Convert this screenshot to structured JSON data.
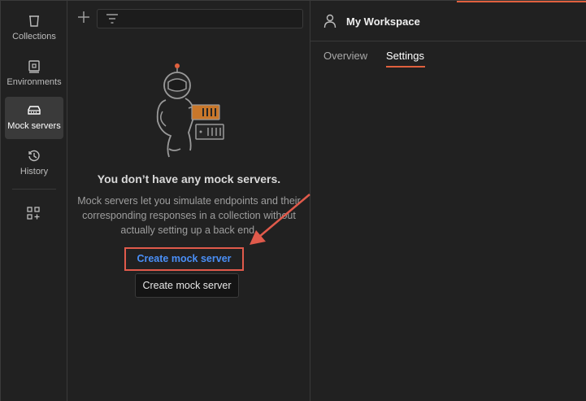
{
  "rail": {
    "items": [
      {
        "label": "Collections",
        "icon": "collections-icon"
      },
      {
        "label": "Environments",
        "icon": "environments-icon"
      },
      {
        "label": "Mock servers",
        "icon": "mock-servers-icon",
        "active": true
      },
      {
        "label": "History",
        "icon": "history-icon"
      }
    ],
    "more_icon": "configure-sidebar-icon"
  },
  "panel": {
    "empty_title": "You don’t have any mock servers.",
    "empty_desc": "Mock servers let you simulate endpoints and their corresponding responses in a collection without actually setting up a back end.",
    "create_link": "Create mock server",
    "tooltip": "Create mock server"
  },
  "workspace": {
    "name": "My Workspace",
    "tabs": [
      {
        "label": "Overview"
      },
      {
        "label": "Settings",
        "active": true
      }
    ]
  },
  "colors": {
    "accent": "#e0603e",
    "link": "#4a8ff7",
    "annotation": "#e05a4b"
  }
}
